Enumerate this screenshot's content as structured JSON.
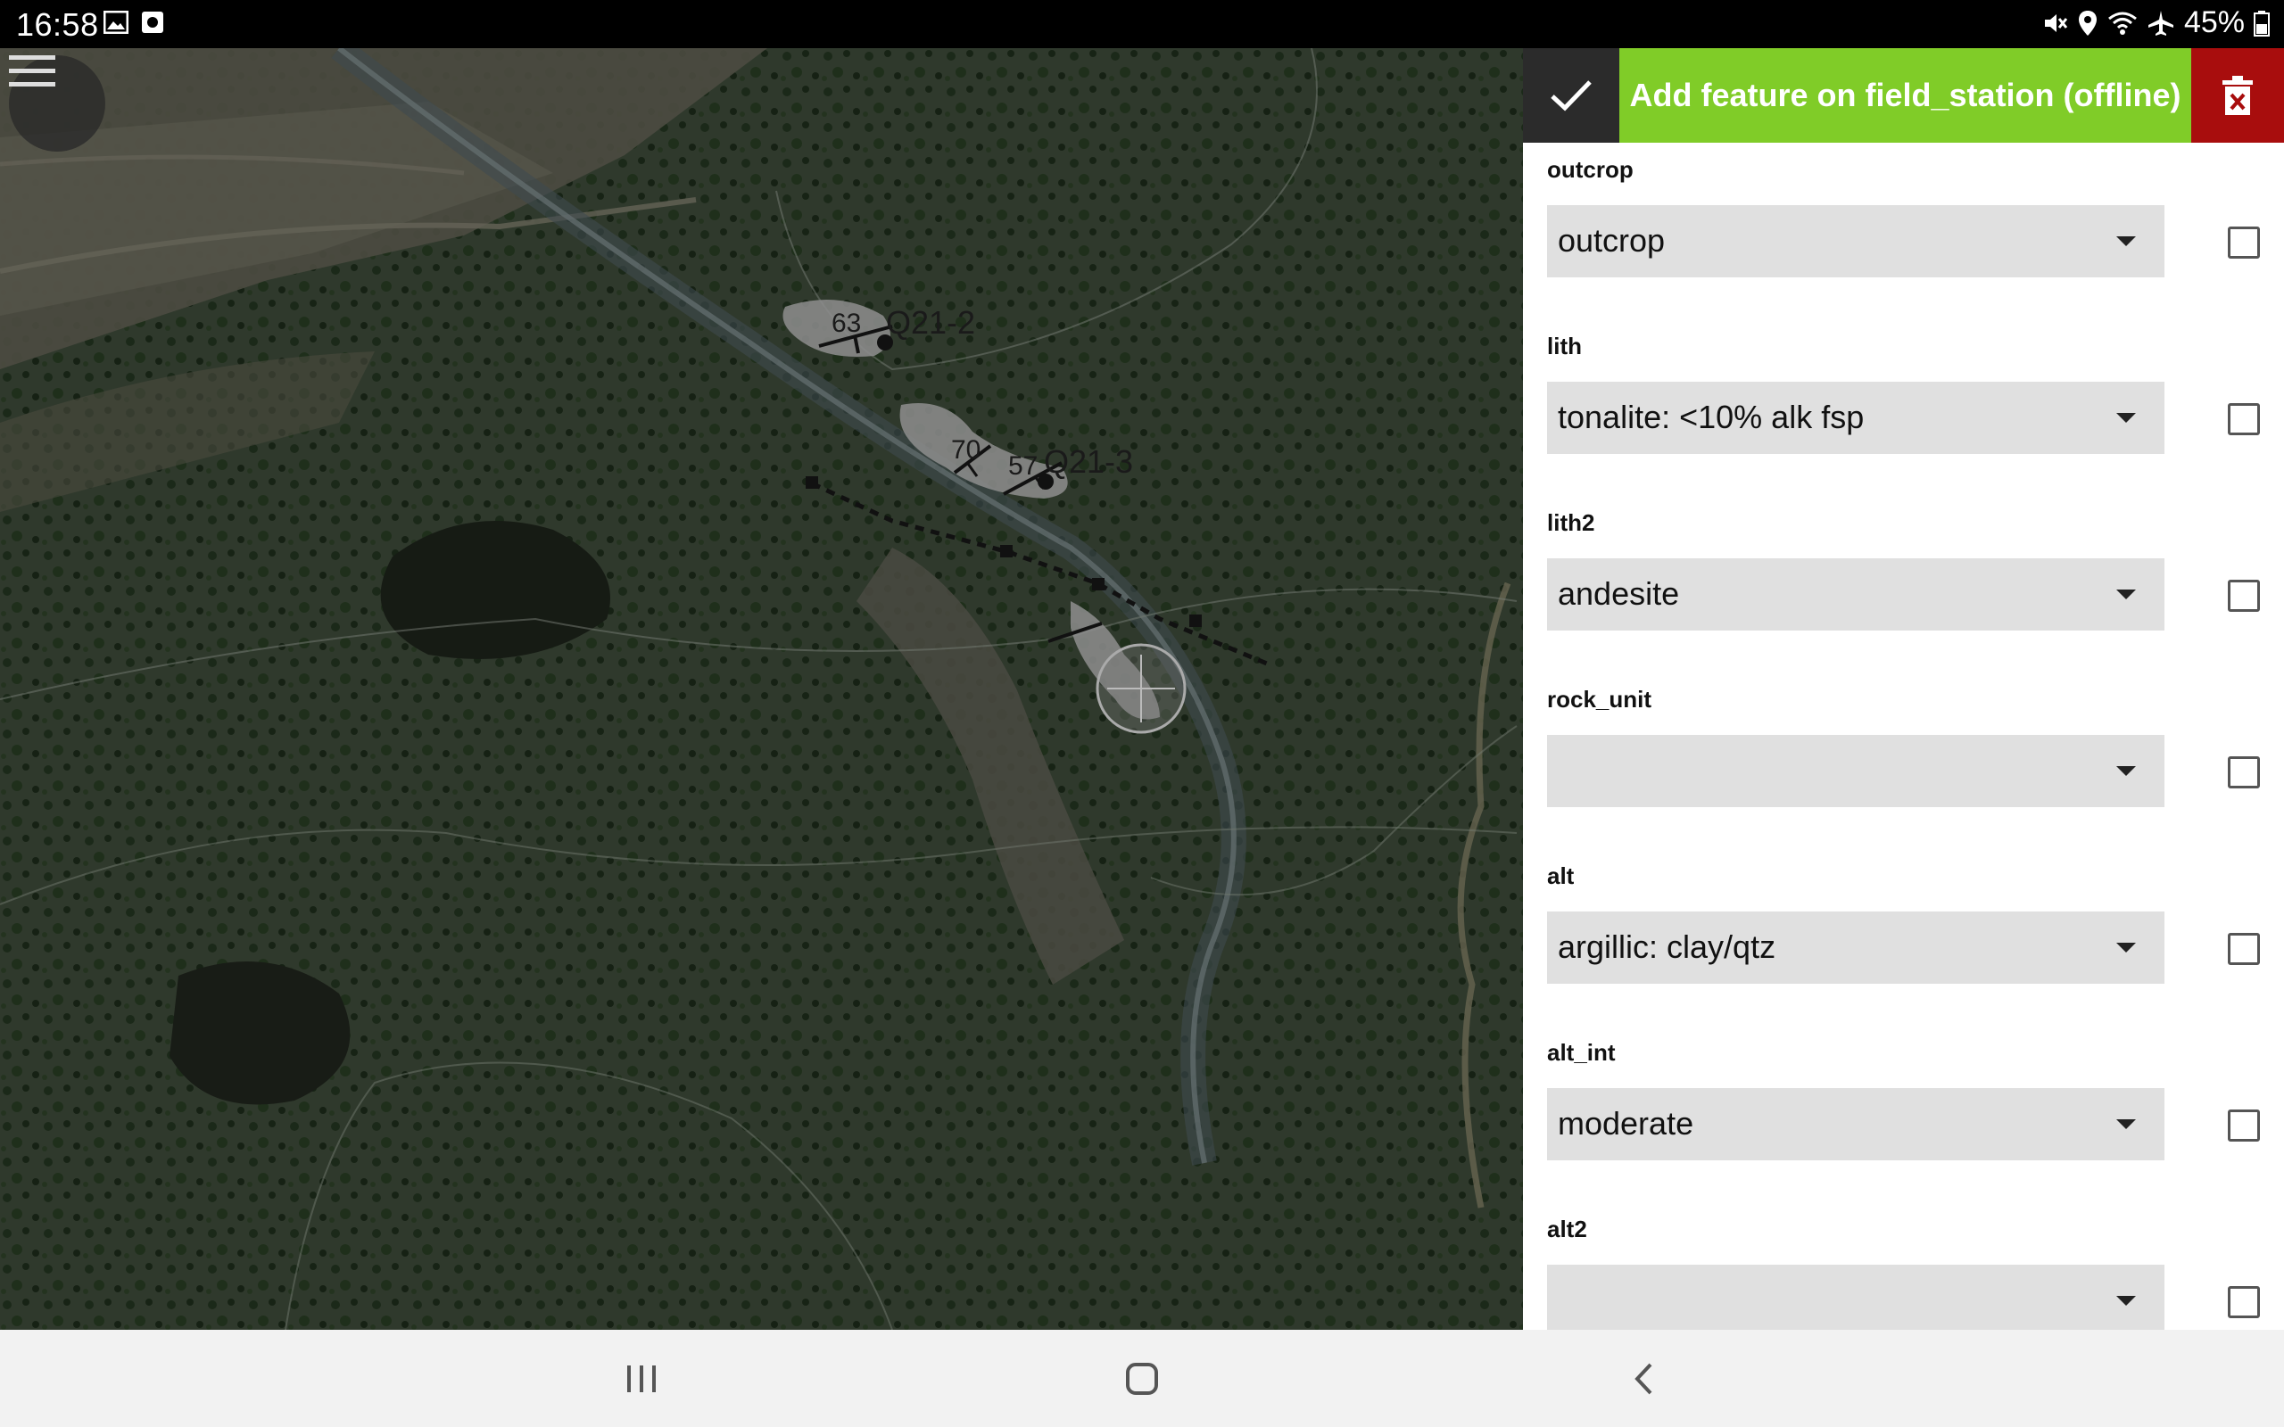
{
  "status_bar": {
    "time": "16:58",
    "battery": "45%",
    "left_icons": [
      "image-icon",
      "screenshot-icon"
    ],
    "right_icons": [
      "mute-icon",
      "location-icon",
      "wifi-icon",
      "airplane-icon",
      "battery-icon"
    ]
  },
  "map": {
    "labels": [
      {
        "text": "63"
      },
      {
        "text": "Q21-2"
      },
      {
        "text": "70"
      },
      {
        "text": "57"
      },
      {
        "text": "Q21-3"
      }
    ]
  },
  "panel": {
    "title": "Add feature on field_station (offline)",
    "accent_color": "#80cc28",
    "delete_color": "#a80d0d",
    "fields": [
      {
        "label": "outcrop",
        "value": "outcrop",
        "checked": false
      },
      {
        "label": "lith",
        "value": "tonalite: <10% alk fsp",
        "checked": false
      },
      {
        "label": "lith2",
        "value": "andesite",
        "checked": false
      },
      {
        "label": "rock_unit",
        "value": "",
        "checked": false
      },
      {
        "label": "alt",
        "value": "argillic: clay/qtz",
        "checked": false
      },
      {
        "label": "alt_int",
        "value": "moderate",
        "checked": false
      },
      {
        "label": "alt2",
        "value": "",
        "checked": false
      }
    ]
  },
  "nav_bar": {
    "buttons": [
      "recent-apps-icon",
      "home-icon",
      "back-icon"
    ]
  }
}
